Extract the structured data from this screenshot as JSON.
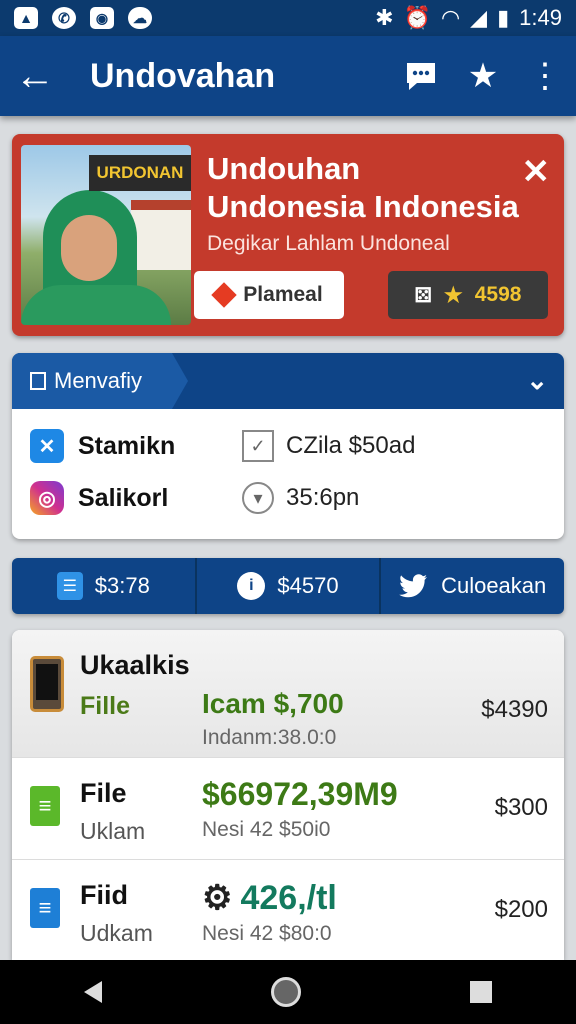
{
  "status_bar": {
    "time": "1:49",
    "left_icons": [
      "image-icon",
      "whatsapp-icon",
      "camera-icon",
      "cloud-icon"
    ],
    "right_icons": [
      "bluetooth-icon",
      "alarm-icon",
      "wifi-icon",
      "signal-icon",
      "battery-icon"
    ]
  },
  "app_bar": {
    "title": "Undovahan",
    "actions": [
      "chat-icon",
      "star-icon",
      "more-vert-icon"
    ]
  },
  "promo": {
    "photo_tag": "URDONAN",
    "title": "Undouhan Undonesia Indonesia",
    "subtitle": "Degikar Lahlam Undoneal",
    "button_label": "Plameal",
    "rating": "4598"
  },
  "menu": {
    "header_label": "Menvafiy",
    "rows": [
      {
        "label": "Stamikn",
        "value": "CZila $50ad"
      },
      {
        "label": "Salikorl",
        "value": "35:6pn"
      }
    ]
  },
  "stats": [
    {
      "label": "$3:78"
    },
    {
      "label": "$4570"
    },
    {
      "label": "Culoeakan"
    }
  ],
  "files": {
    "header": {
      "name": "Ukaalkis",
      "sub": "Fille",
      "mid": "Icam $,700",
      "mid_sub": "Indanm:38.0:0",
      "price": "$4390"
    },
    "rows": [
      {
        "name": "File",
        "sub": "Uklam",
        "mid": "$66972,39M9",
        "mid_sub": "Nesi 42 $50i0",
        "price": "$300"
      },
      {
        "name": "Fiid",
        "sub": "Udkam",
        "mid": "426,/tl",
        "mid_sub": "Nesi 42 $80:0",
        "price": "$200"
      }
    ]
  },
  "colors": {
    "primary": "#0e4487",
    "promo_red": "#c43a2c",
    "accent_green": "#3d7a16",
    "teal": "#137a5e",
    "gold": "#f2c531"
  }
}
